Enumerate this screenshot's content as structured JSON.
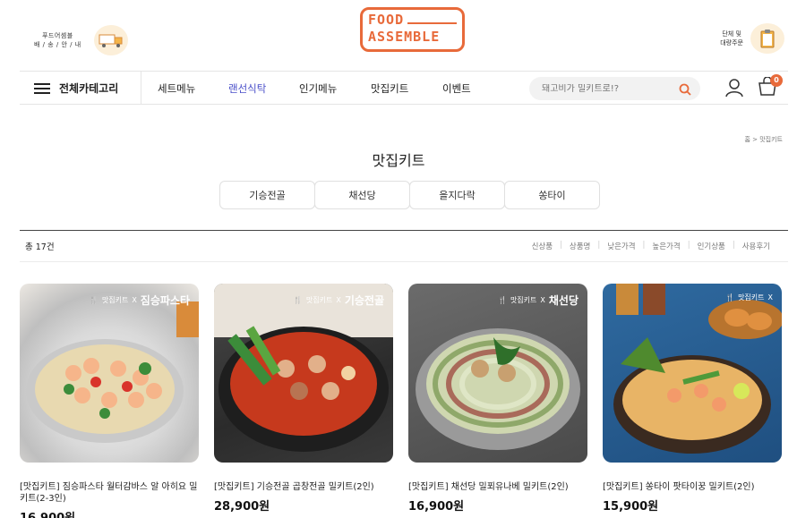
{
  "header": {
    "delivery_text_line1": "푸드어셈블",
    "delivery_text_line2": "배 / 송 / 안 / 내",
    "logo_line1": "FOOD",
    "logo_line2": "ASSEMBLE",
    "bulk_text_line1": "단체 및",
    "bulk_text_line2": "대량주문"
  },
  "nav": {
    "all_categories": "전체카테고리",
    "items": [
      {
        "label": "세트메뉴",
        "active": false
      },
      {
        "label": "랜선식탁",
        "active": true
      },
      {
        "label": "인기메뉴",
        "active": false
      },
      {
        "label": "맛집키트",
        "active": false
      },
      {
        "label": "이벤트",
        "active": false
      }
    ],
    "search_placeholder": "돼고비가 밀키트로!?",
    "cart_count": "0"
  },
  "breadcrumb": "홈 > 맛집키트",
  "page_title": "맛집키트",
  "category_tabs": [
    "기승전골",
    "채선당",
    "을지다락",
    "쏭타이"
  ],
  "list": {
    "count": "총 17건",
    "sort_options": [
      "신상품",
      "상품명",
      "낮은가격",
      "높은가격",
      "인기상품",
      "사용후기"
    ]
  },
  "products": [
    {
      "name": "[맛집키트] 짐승파스타 월터감바스 알 아히요 밀키트(2-3인)",
      "price": "16,900원",
      "brand": "짐승파스타"
    },
    {
      "name": "[맛집키트] 기승전골 곱창전골 밀키트(2인)",
      "price": "28,900원",
      "brand": "기승전골"
    },
    {
      "name": "[맛집키트] 채선당 밀푀유나베 밀키트(2인)",
      "price": "16,900원",
      "brand": "채선당"
    },
    {
      "name": "[맛집키트] 쏭타이 팟타이꿍 밀키트(2인)",
      "price": "15,900원",
      "brand": ""
    }
  ],
  "kit_label": "맛집키트",
  "colors": {
    "brand_orange": "#e86a3a",
    "nav_active": "#4a4fc9"
  }
}
